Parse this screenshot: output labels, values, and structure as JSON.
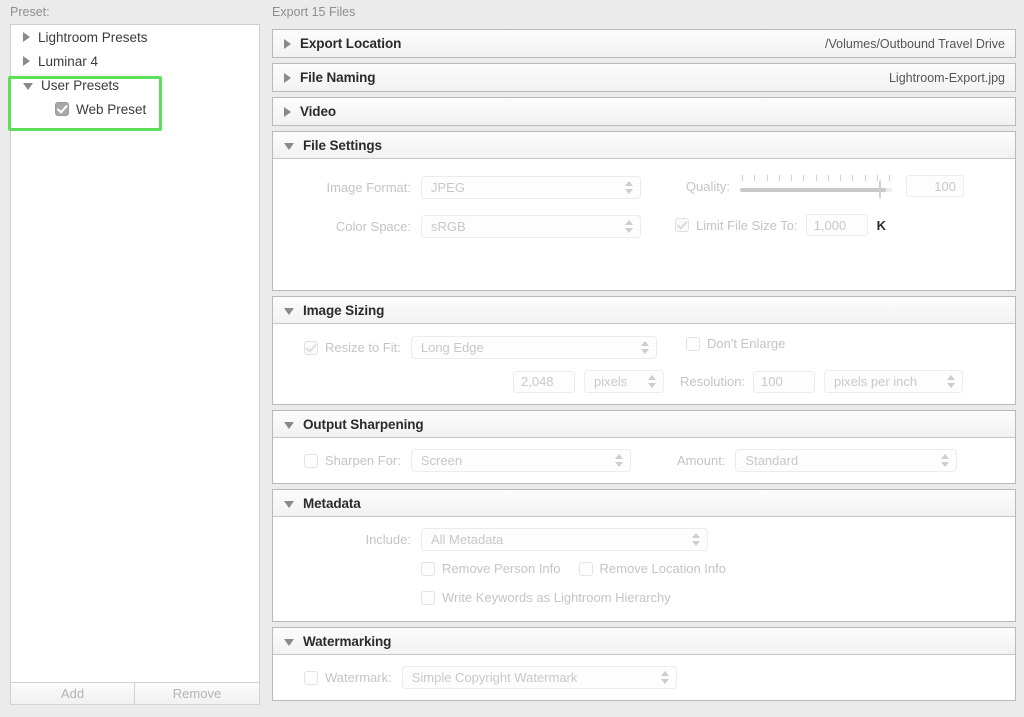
{
  "left": {
    "preset_label": "Preset:",
    "tree": [
      {
        "label": "Lightroom Presets",
        "disclosure": "triangle-right",
        "level": 1,
        "checkbox": null
      },
      {
        "label": "Luminar 4",
        "disclosure": "triangle-right",
        "level": 1,
        "checkbox": null
      },
      {
        "label": "User Presets",
        "disclosure": "triangle-down",
        "level": 1,
        "checkbox": null
      },
      {
        "label": "Web Preset",
        "disclosure": null,
        "level": 2,
        "checkbox": "checked"
      }
    ],
    "highlight_color": "#5ce05c",
    "buttons": {
      "add": "Add",
      "remove": "Remove"
    }
  },
  "main": {
    "title": "Export 15 Files",
    "panels": {
      "export_location": {
        "title": "Export Location",
        "summary": "/Volumes/Outbound Travel Drive",
        "state": "collapsed",
        "disclosure": "triangle-right"
      },
      "file_naming": {
        "title": "File Naming",
        "summary": "Lightroom-Export.jpg",
        "state": "collapsed",
        "disclosure": "triangle-right"
      },
      "video": {
        "title": "Video",
        "summary": "",
        "state": "collapsed",
        "disclosure": "triangle-right"
      },
      "file_settings": {
        "title": "File Settings",
        "state": "expanded",
        "disclosure": "triangle-down",
        "image_format_label": "Image Format:",
        "image_format_value": "JPEG",
        "color_space_label": "Color Space:",
        "color_space_value": "sRGB",
        "quality_label": "Quality:",
        "quality_value": "100",
        "quality_percent": 100,
        "quality_ticks": 13,
        "limit_file_size_label": "Limit File Size To:",
        "limit_file_size_checked": true,
        "limit_file_size_value": "1,000",
        "limit_file_size_units": "K"
      },
      "image_sizing": {
        "title": "Image Sizing",
        "state": "expanded",
        "disclosure": "triangle-down",
        "resize_to_fit_label": "Resize to Fit:",
        "resize_to_fit_checked": true,
        "resize_mode_value": "Long Edge",
        "dont_enlarge_label": "Don't Enlarge",
        "dont_enlarge_checked": false,
        "size_value": "2,048",
        "size_units_value": "pixels",
        "resolution_label": "Resolution:",
        "resolution_value": "100",
        "resolution_units_value": "pixels per inch"
      },
      "output_sharpening": {
        "title": "Output Sharpening",
        "state": "expanded",
        "disclosure": "triangle-down",
        "sharpen_for_label": "Sharpen For:",
        "sharpen_for_checked": false,
        "sharpen_for_value": "Screen",
        "amount_label": "Amount:",
        "amount_value": "Standard"
      },
      "metadata": {
        "title": "Metadata",
        "state": "expanded",
        "disclosure": "triangle-down",
        "include_label": "Include:",
        "include_value": "All Metadata",
        "remove_person_info_label": "Remove Person Info",
        "remove_person_info_checked": false,
        "remove_location_info_label": "Remove Location Info",
        "remove_location_info_checked": false,
        "write_keywords_label": "Write Keywords as Lightroom Hierarchy",
        "write_keywords_checked": false
      },
      "watermarking": {
        "title": "Watermarking",
        "state": "expanded",
        "disclosure": "triangle-down",
        "watermark_label": "Watermark:",
        "watermark_checked": false,
        "watermark_value": "Simple Copyright Watermark"
      }
    }
  }
}
